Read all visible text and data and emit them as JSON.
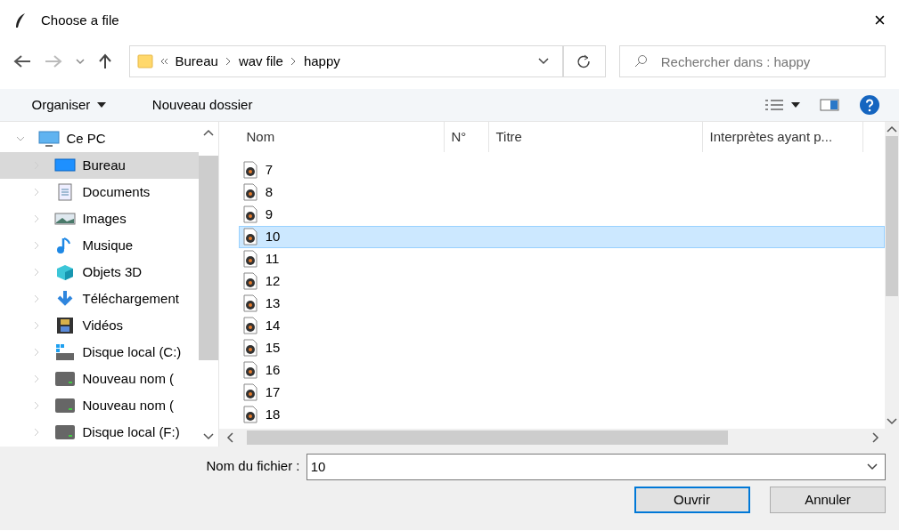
{
  "window": {
    "title": "Choose a file",
    "close": "×"
  },
  "nav": {
    "breadcrumb": [
      "Bureau",
      "wav file",
      "happy"
    ],
    "search": {
      "placeholder": "Rechercher dans : happy"
    }
  },
  "toolbar": {
    "organise": "Organiser",
    "new_folder": "Nouveau dossier"
  },
  "sidebar": {
    "items": [
      {
        "label": "Ce PC",
        "kind": "pc",
        "expanded": true,
        "selected": false,
        "children": [
          {
            "label": "Bureau",
            "kind": "desktop",
            "expanded": false,
            "selected": true
          },
          {
            "label": "Documents",
            "kind": "documents",
            "expanded": false,
            "selected": false
          },
          {
            "label": "Images",
            "kind": "images",
            "expanded": false,
            "selected": false
          },
          {
            "label": "Musique",
            "kind": "music",
            "expanded": false,
            "selected": false
          },
          {
            "label": "Objets 3D",
            "kind": "cube",
            "expanded": false,
            "selected": false
          },
          {
            "label": "Téléchargement",
            "kind": "download",
            "expanded": false,
            "selected": false
          },
          {
            "label": "Vidéos",
            "kind": "videos",
            "expanded": false,
            "selected": false
          },
          {
            "label": "Disque local (C:)",
            "kind": "system-drive",
            "expanded": false,
            "selected": false
          },
          {
            "label": "Nouveau nom (",
            "kind": "drive",
            "expanded": false,
            "selected": false
          },
          {
            "label": "Nouveau nom (",
            "kind": "drive",
            "expanded": false,
            "selected": false
          },
          {
            "label": "Disque local (F:)",
            "kind": "drive",
            "expanded": false,
            "selected": false
          }
        ]
      }
    ]
  },
  "table": {
    "columns": [
      "Nom",
      "N°",
      "Titre",
      "Interprètes ayant p..."
    ],
    "rows": [
      {
        "name": "7",
        "selected": false
      },
      {
        "name": "8",
        "selected": false
      },
      {
        "name": "9",
        "selected": false
      },
      {
        "name": "10",
        "selected": true
      },
      {
        "name": "11",
        "selected": false
      },
      {
        "name": "12",
        "selected": false
      },
      {
        "name": "13",
        "selected": false
      },
      {
        "name": "14",
        "selected": false
      },
      {
        "name": "15",
        "selected": false
      },
      {
        "name": "16",
        "selected": false
      },
      {
        "name": "17",
        "selected": false
      },
      {
        "name": "18",
        "selected": false
      }
    ]
  },
  "footer": {
    "filename_label": "Nom du fichier :",
    "filename": "10",
    "buttons": [
      {
        "label": "Ouvrir",
        "default": true
      },
      {
        "label": "Annuler",
        "default": false
      }
    ]
  }
}
